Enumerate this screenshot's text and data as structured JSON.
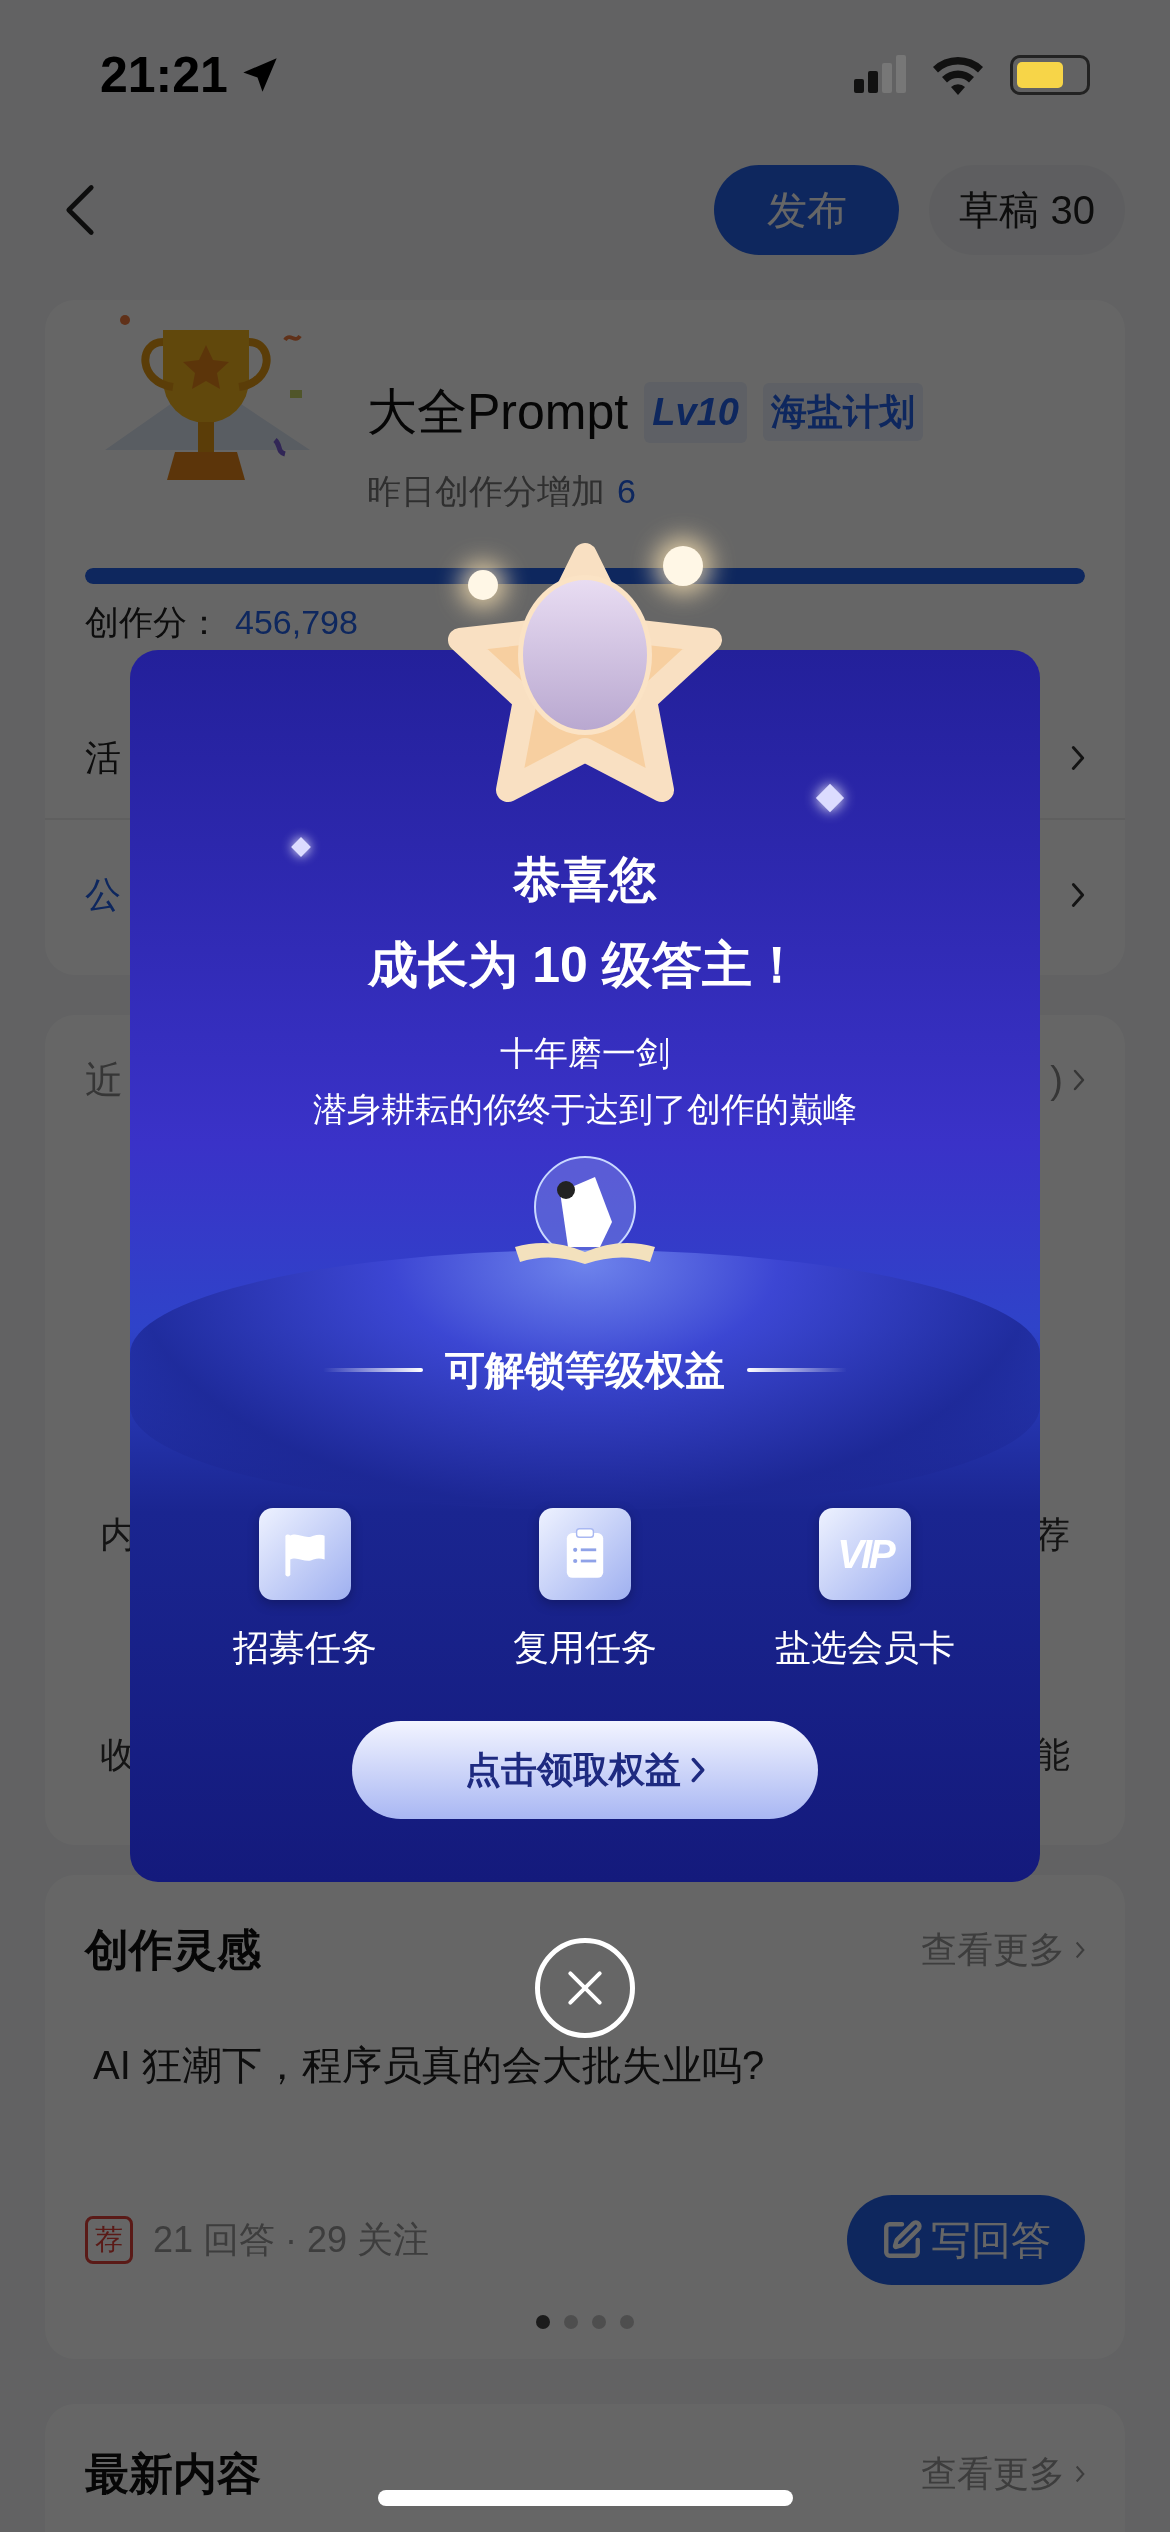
{
  "status_bar": {
    "time": "21:21"
  },
  "nav": {
    "publish": "发布",
    "drafts": "草稿 30"
  },
  "profile": {
    "name": "大全Prompt",
    "level_badge": "Lv10",
    "tag": "海盐计划",
    "subtitle": "昨日创作分增加",
    "subtitle_value": "6",
    "progress": {
      "level": 1
    },
    "score_label": "创作分：",
    "score": "456,798"
  },
  "profile_rows": [
    {
      "label": "活",
      "kind": "plain"
    },
    {
      "label": "公",
      "kind": "link"
    }
  ],
  "stats_card": {
    "label": "近",
    "suffix": ")",
    "rows": [
      {
        "left": "内",
        "right": "荐"
      },
      {
        "left": "收",
        "right": "能"
      }
    ]
  },
  "inspiration": {
    "title": "创作灵感",
    "more": "查看更多",
    "question": "AI 狂潮下，程序员真的会大批失业吗?",
    "badge": "荐",
    "meta": "21 回答 · 29 关注",
    "answer_button": "写回答",
    "dots": [
      {
        "selected": true
      },
      {
        "selected": false
      },
      {
        "selected": false
      },
      {
        "selected": false
      }
    ]
  },
  "latest": {
    "title": "最新内容",
    "more": "查看更多"
  },
  "modal": {
    "title": "恭喜您",
    "headline": "成长为 10 级答主！",
    "motto": "十年磨一剑",
    "message": "潜身耕耘的你终于达到了创作的巅峰",
    "benefits_title": "可解锁等级权益",
    "benefits": [
      {
        "kind": "flag",
        "label": "招募任务"
      },
      {
        "kind": "clipboard",
        "label": "复用任务"
      },
      {
        "kind": "vip",
        "label": "盐选会员卡",
        "icon_text": "VIP"
      }
    ],
    "cta": "点击领取权益"
  }
}
